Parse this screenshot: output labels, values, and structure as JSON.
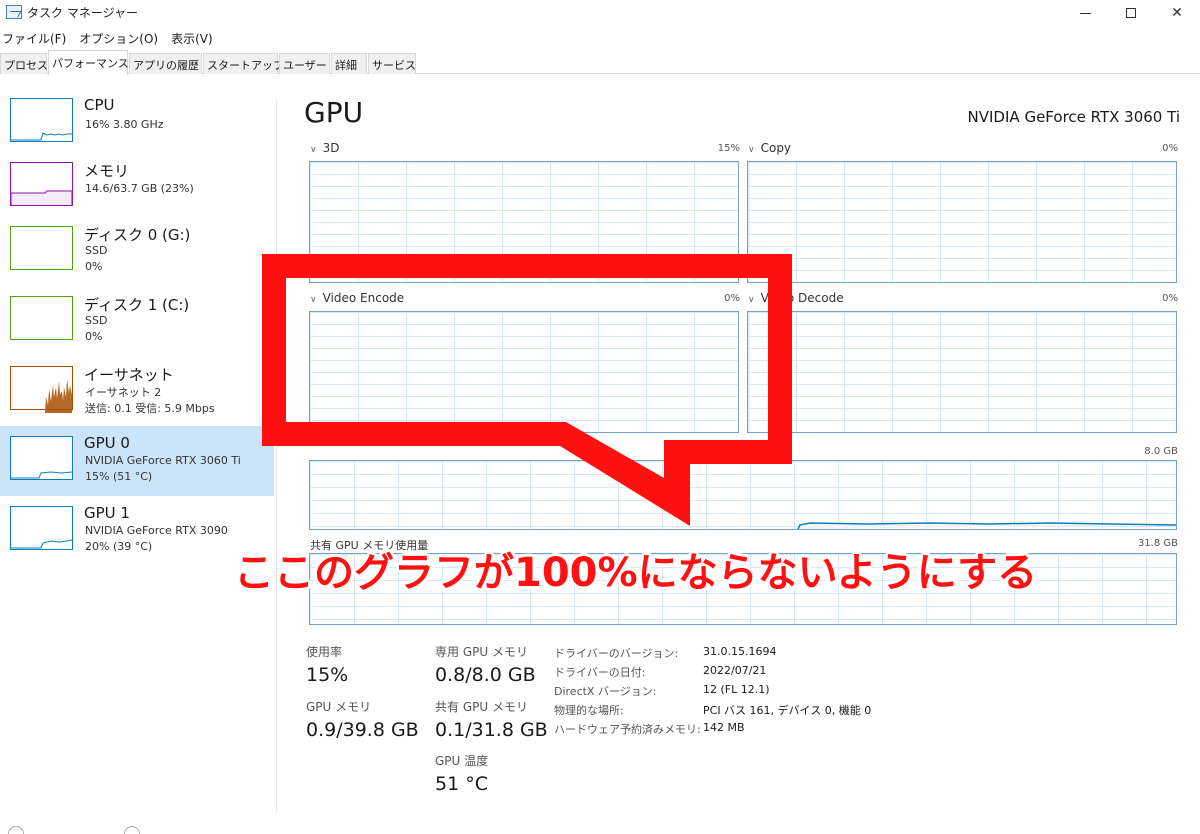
{
  "window": {
    "title": "タスク マネージャー"
  },
  "menu": [
    "ファイル(F)",
    "オプション(O)",
    "表示(V)"
  ],
  "tabs": [
    "プロセス",
    "パフォーマンス",
    "アプリの履歴",
    "スタートアップ",
    "ユーザー",
    "詳細",
    "サービス"
  ],
  "active_tab": "パフォーマンス",
  "sidebar": {
    "items": [
      {
        "title": "CPU",
        "sub1": "16%  3.80 GHz",
        "sub2": "",
        "color": "#117dbb"
      },
      {
        "title": "メモリ",
        "sub1": "14.6/63.7 GB (23%)",
        "sub2": "",
        "color": "#8b12ae"
      },
      {
        "title": "ディスク 0 (G:)",
        "sub1": "SSD",
        "sub2": "0%",
        "color": "#4da60c"
      },
      {
        "title": "ディスク 1 (C:)",
        "sub1": "SSD",
        "sub2": "0%",
        "color": "#4da60c"
      },
      {
        "title": "イーサネット",
        "sub1": "イーサネット 2",
        "sub2": "送信: 0.1  受信: 5.9 Mbps",
        "color": "#a74f01"
      },
      {
        "title": "GPU 0",
        "sub1": "NVIDIA GeForce RTX 3060 Ti",
        "sub2": "15%  (51 °C)",
        "color": "#117dbb",
        "selected": true
      },
      {
        "title": "GPU 1",
        "sub1": "NVIDIA GeForce RTX 3090",
        "sub2": "20%  (39 °C)",
        "color": "#117dbb"
      }
    ]
  },
  "main": {
    "title": "GPU",
    "gpu_name": "NVIDIA GeForce RTX 3060 Ti",
    "graphs": [
      {
        "label": "3D",
        "pct": "15%"
      },
      {
        "label": "Copy",
        "pct": "0%"
      },
      {
        "label": "Video Encode",
        "pct": "0%"
      },
      {
        "label": "Video Decode",
        "pct": "0%"
      }
    ],
    "dedicated_mem_max": "8.0 GB",
    "shared_mem_label": "共有 GPU メモリ使用量",
    "shared_mem_max": "31.8 GB"
  },
  "stats": {
    "usage_label": "使用率",
    "usage_value": "15%",
    "gpu_mem_label": "GPU メモリ",
    "gpu_mem_value": "0.9/39.8 GB",
    "dedicated_label": "専用 GPU メモリ",
    "dedicated_value": "0.8/8.0 GB",
    "shared_label": "共有 GPU メモリ",
    "shared_value": "0.1/31.8 GB",
    "temp_label": "GPU 温度",
    "temp_value": "51 °C"
  },
  "info": [
    {
      "key": "ドライバーのバージョン:",
      "value": "31.0.15.1694"
    },
    {
      "key": "ドライバーの日付:",
      "value": "2022/07/21"
    },
    {
      "key": "DirectX バージョン:",
      "value": "12 (FL 12.1)"
    },
    {
      "key": "物理的な場所:",
      "value": "PCI バス 161, デバイス 0, 機能 0"
    },
    {
      "key": "ハードウェア予約済みメモリ:",
      "value": "142 MB"
    }
  ],
  "annotation": {
    "text": "ここのグラフが100%にならないようにする",
    "color": "#ff1111"
  }
}
